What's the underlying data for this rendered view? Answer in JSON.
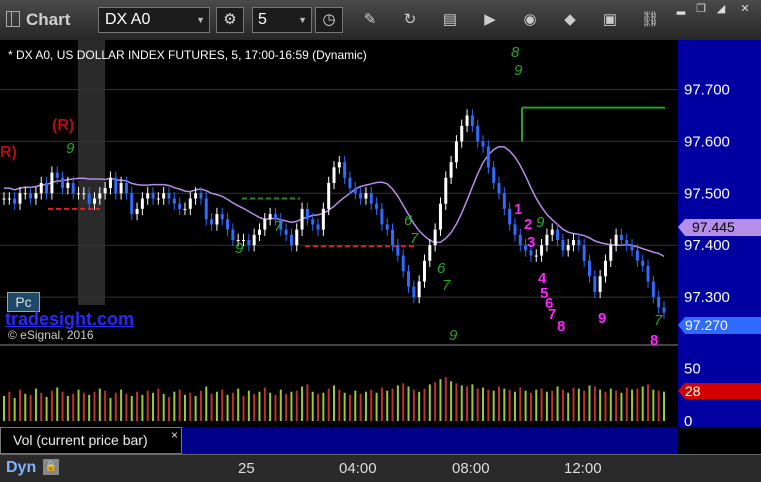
{
  "toolbar": {
    "app_title": "Chart",
    "symbol": "DX A0",
    "interval": "5"
  },
  "chart_header": "* DX A0, US DOLLAR INDEX FUTURES, 5, 17:00-16:59 (Dynamic)",
  "watermark": {
    "brand": "tradesight.com",
    "copyright": "© eSignal, 2016",
    "badge": "Pc"
  },
  "chart_data": {
    "type": "candlestick",
    "price_axis": {
      "ticks": [
        "97.700",
        "97.600",
        "97.500",
        "97.400",
        "97.300"
      ],
      "range": [
        97.225,
        97.78
      ]
    },
    "last_price_label": "97.270",
    "ma_price_label": "97.445",
    "volume_axis": {
      "ticks": [
        "50",
        "0"
      ],
      "range": [
        0,
        65
      ]
    },
    "volume_label": "28",
    "time_axis": [
      "25",
      "04:00",
      "08:00",
      "12:00"
    ],
    "td_sequential_labels": {
      "green": [
        "9",
        "8",
        "9",
        "9",
        "6",
        "7",
        "6",
        "7",
        "9",
        "9",
        "7",
        "7"
      ],
      "magenta": [
        "1",
        "2",
        "3",
        "4",
        "5",
        "6",
        "7",
        "8",
        "9",
        "1",
        "8"
      ],
      "markers": [
        "(R)",
        "R)"
      ]
    },
    "closes": [
      97.49,
      97.49,
      97.48,
      97.5,
      97.5,
      97.49,
      97.5,
      97.52,
      97.5,
      97.54,
      97.53,
      97.51,
      97.52,
      97.5,
      97.5,
      97.5,
      97.48,
      97.49,
      97.5,
      97.51,
      97.53,
      97.5,
      97.52,
      97.5,
      97.46,
      97.47,
      97.49,
      97.5,
      97.49,
      97.49,
      97.5,
      97.49,
      97.48,
      97.47,
      97.47,
      97.49,
      97.5,
      97.49,
      97.45,
      97.44,
      97.46,
      97.45,
      97.43,
      97.41,
      97.41,
      97.41,
      97.4,
      97.42,
      97.43,
      97.45,
      97.46,
      97.45,
      97.43,
      97.42,
      97.4,
      97.43,
      97.47,
      97.45,
      97.44,
      97.43,
      97.47,
      97.52,
      97.55,
      97.56,
      97.53,
      97.51,
      97.5,
      97.49,
      97.5,
      97.48,
      97.47,
      97.44,
      97.43,
      97.4,
      97.38,
      97.35,
      97.32,
      97.3,
      97.33,
      97.37,
      97.4,
      97.43,
      97.48,
      97.53,
      97.56,
      97.6,
      97.63,
      97.65,
      97.63,
      97.6,
      97.59,
      97.55,
      97.52,
      97.5,
      97.47,
      97.44,
      97.42,
      97.4,
      97.39,
      97.38,
      97.38,
      97.4,
      97.42,
      97.43,
      97.41,
      97.39,
      97.4,
      97.41,
      97.4,
      97.37,
      97.34,
      97.31,
      97.34,
      97.37,
      97.4,
      97.42,
      97.41,
      97.4,
      97.39,
      97.37,
      97.36,
      97.33,
      97.3,
      97.28,
      97.27
    ],
    "volumes": [
      24,
      28,
      22,
      30,
      26,
      25,
      31,
      27,
      23,
      29,
      32,
      28,
      24,
      26,
      30,
      27,
      25,
      28,
      31,
      29,
      22,
      27,
      30,
      26,
      24,
      28,
      25,
      29,
      27,
      31,
      26,
      23,
      28,
      30,
      25,
      27,
      24,
      29,
      33,
      26,
      28,
      30,
      25,
      27,
      31,
      24,
      29,
      26,
      28,
      32,
      27,
      25,
      30,
      26,
      28,
      29,
      33,
      35,
      28,
      26,
      27,
      31,
      34,
      30,
      27,
      25,
      29,
      26,
      28,
      30,
      27,
      32,
      29,
      31,
      34,
      36,
      33,
      30,
      28,
      31,
      35,
      37,
      40,
      42,
      38,
      36,
      34,
      33,
      35,
      31,
      32,
      30,
      29,
      33,
      31,
      30,
      28,
      32,
      29,
      27,
      30,
      31,
      28,
      29,
      33,
      30,
      27,
      32,
      31,
      29,
      34,
      33,
      30,
      28,
      31,
      29,
      27,
      32,
      30,
      31,
      33,
      35,
      30,
      29,
      28
    ]
  }
}
